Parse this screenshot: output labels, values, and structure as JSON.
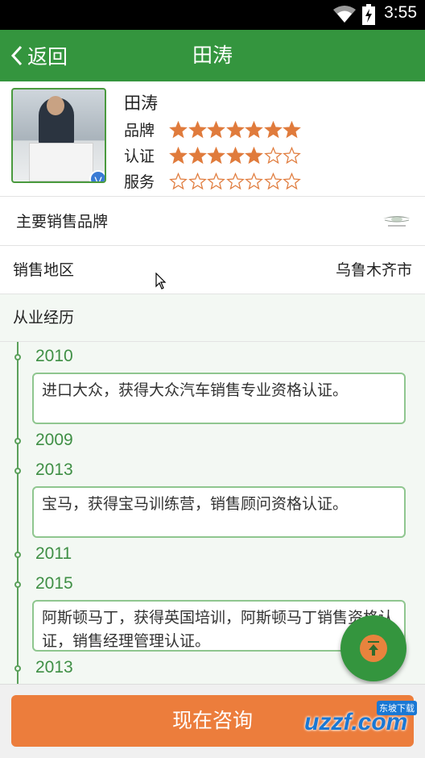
{
  "status_bar": {
    "time": "3:55",
    "wifi_icon": "wifi-icon",
    "battery_icon": "battery-charging-icon"
  },
  "app_bar": {
    "back_label": "返回",
    "title": "田涛"
  },
  "profile": {
    "name": "田涛",
    "ratings": [
      {
        "label": "品牌",
        "filled": 7,
        "total": 7
      },
      {
        "label": "认证",
        "filled": 5,
        "total": 7
      },
      {
        "label": "服务",
        "filled": 0,
        "total": 7
      }
    ],
    "verified_badge": "V",
    "star_color": "#e07b3c"
  },
  "brand_row": {
    "label": "主要销售品牌",
    "logo_icon": "aston-martin-logo"
  },
  "region_row": {
    "label": "销售地区",
    "value": "乌鲁木齐市"
  },
  "experience_row": {
    "label": "从业经历"
  },
  "timeline": [
    {
      "year": "2010",
      "text": "进口大众，获得大众汽车销售专业资格认证。"
    },
    {
      "year": "2009",
      "text": ""
    },
    {
      "year": "2013",
      "text": "宝马，获得宝马训练营，销售顾问资格认证。"
    },
    {
      "year": "2011",
      "text": ""
    },
    {
      "year": "2015",
      "text": "阿斯顿马丁，获得英国培训，阿斯顿马丁销售资格认证，销售经理管理认证。"
    },
    {
      "year": "2013",
      "text": ""
    }
  ],
  "bottom": {
    "consult_label": "现在咨询",
    "watermark_text": "uzzf.com",
    "watermark_sub": "东坡下载"
  },
  "colors": {
    "primary": "#34953e",
    "accent": "#ec7d3c"
  }
}
